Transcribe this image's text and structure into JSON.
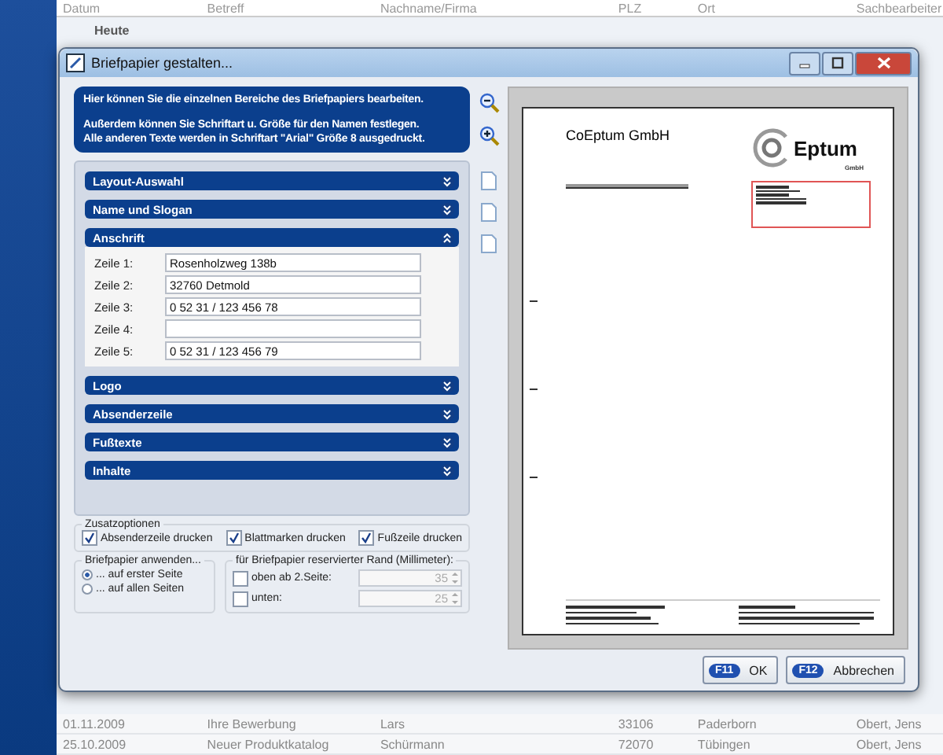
{
  "background": {
    "columns": [
      "Datum",
      "Betreff",
      "Nachname/Firma",
      "PLZ",
      "Ort",
      "Sachbearbeiter"
    ],
    "group": "Heute",
    "rows": [
      {
        "cells": [
          "01.11.2009",
          "Ihre Bewerbung",
          "Lars",
          "33106",
          "Paderborn",
          "Obert, Jens"
        ]
      },
      {
        "cells": [
          "25.10.2009",
          "Neuer Produktkatalog",
          "Schürmann",
          "72070",
          "Tübingen",
          "Obert, Jens"
        ]
      }
    ]
  },
  "dialog": {
    "title": "Briefpapier gestalten...",
    "info": [
      "Hier können Sie die einzelnen Bereiche des Briefpapiers bearbeiten.",
      "Außerdem können Sie Schriftart u. Größe für den Namen festlegen.",
      "Alle anderen Texte werden in Schriftart \"Arial\" Größe 8 ausgedruckt."
    ],
    "sections": [
      {
        "title": "Layout-Auswahl",
        "expanded": false
      },
      {
        "title": "Name und Slogan",
        "expanded": false
      },
      {
        "title": "Anschrift",
        "expanded": true,
        "fields": [
          {
            "label": "Zeile 1:",
            "value": "Rosenholzweg 138b"
          },
          {
            "label": "Zeile 2:",
            "value": "32760 Detmold"
          },
          {
            "label": "Zeile 3:",
            "value": "0 52 31 / 123 456 78"
          },
          {
            "label": "Zeile 4:"
          },
          {
            "label": "Zeile 5:",
            "value": "0 52 31 / 123 456 79"
          }
        ]
      },
      {
        "title": "Logo",
        "expanded": false
      },
      {
        "title": "Absenderzeile",
        "expanded": false
      },
      {
        "title": "Fußtexte",
        "expanded": false
      },
      {
        "title": "Inhalte",
        "expanded": false
      }
    ],
    "options": {
      "title": "Zusatzoptionen",
      "items": [
        {
          "label": "Absenderzeile drucken",
          "checked": true
        },
        {
          "label": "Blattmarken drucken",
          "checked": true
        },
        {
          "label": "Fußzeile drucken",
          "checked": true
        }
      ]
    },
    "apply": {
      "title": "Briefpapier anwenden...",
      "items": [
        {
          "label": "... auf erster Seite",
          "selected": true
        },
        {
          "label": "... auf allen Seiten",
          "selected": false
        }
      ]
    },
    "margin": {
      "title": "für Briefpapier reservierter Rand (Millimeter):",
      "items": [
        {
          "label": "oben ab 2.Seite:",
          "checked": false,
          "value": "35",
          "disabled": true
        },
        {
          "label": "unten:",
          "checked": false,
          "value": "25",
          "disabled": true
        }
      ]
    },
    "preview": {
      "company": "CoEptum GmbH",
      "logo_text": "Eptum",
      "logo_sub": "GmbH"
    },
    "buttons": [
      {
        "key": "F11",
        "label": "OK"
      },
      {
        "key": "F12",
        "label": "Abbrechen"
      }
    ]
  }
}
